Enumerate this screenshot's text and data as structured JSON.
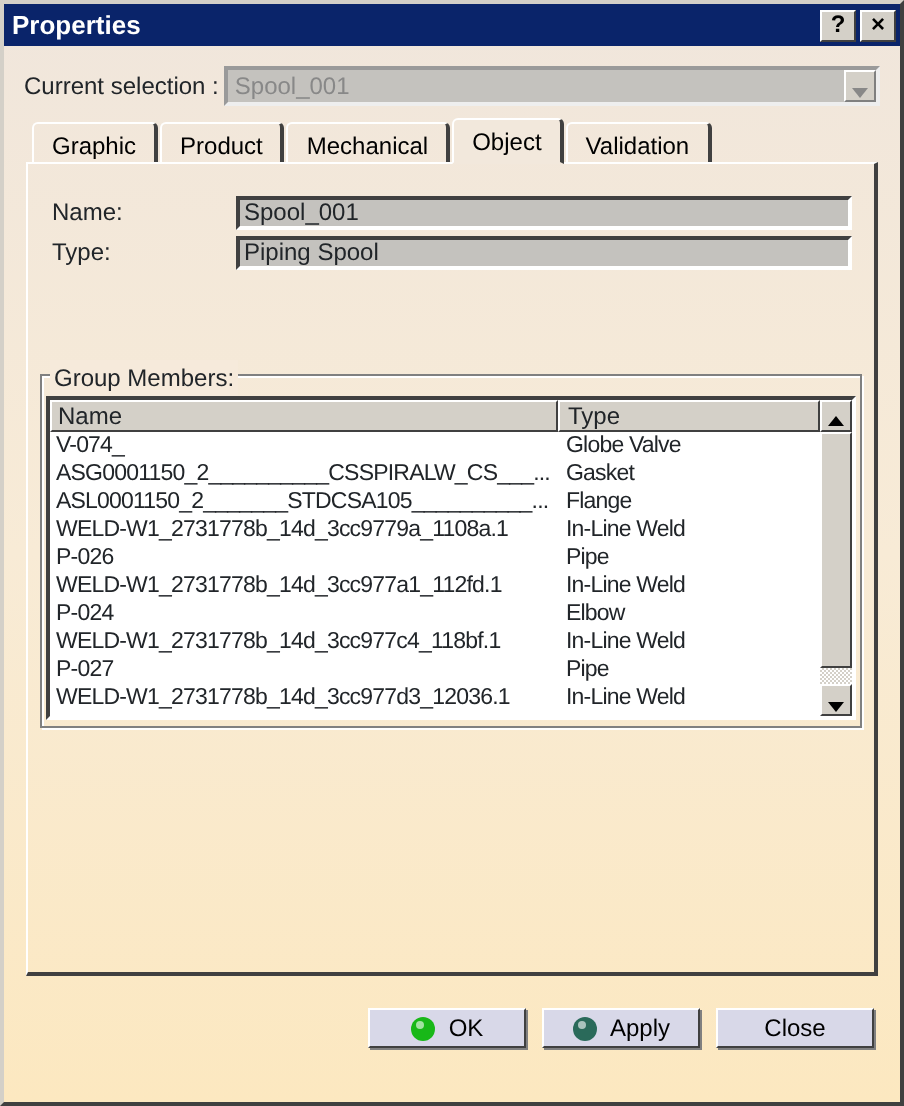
{
  "window": {
    "title": "Properties",
    "title_buttons": [
      "?",
      "×"
    ]
  },
  "current_selection": {
    "label": "Current selection :",
    "value": "Spool_001",
    "disabled": true
  },
  "tabs": [
    {
      "label": "Graphic",
      "selected": false
    },
    {
      "label": "Product",
      "selected": false
    },
    {
      "label": "Mechanical",
      "selected": false
    },
    {
      "label": "Object",
      "selected": true
    },
    {
      "label": "Validation",
      "selected": false
    }
  ],
  "fields": [
    {
      "label": "Name:",
      "value": "Spool_001"
    },
    {
      "label": "Type:",
      "value": "Piping Spool"
    }
  ],
  "group_members": {
    "title": "Group Members:",
    "columns": [
      "Name",
      "Type"
    ],
    "rows": [
      [
        "V-074_",
        "Globe Valve"
      ],
      [
        "ASG0001150_2__________CSSPIRALW_CS___...",
        "Gasket"
      ],
      [
        "ASL0001150_2_______STDCSA105__________...",
        "Flange"
      ],
      [
        "WELD-W1_2731778b_14d_3cc9779a_1108a.1",
        "In-Line Weld"
      ],
      [
        "P-026",
        "Pipe"
      ],
      [
        "WELD-W1_2731778b_14d_3cc977a1_112fd.1",
        "In-Line Weld"
      ],
      [
        "P-024",
        "Elbow"
      ],
      [
        "WELD-W1_2731778b_14d_3cc977c4_118bf.1",
        "In-Line Weld"
      ],
      [
        "P-027",
        "Pipe"
      ],
      [
        "WELD-W1_2731778b_14d_3cc977d3_12036.1",
        "In-Line Weld"
      ]
    ]
  },
  "buttons": [
    {
      "label": "OK",
      "color": "#18b818"
    },
    {
      "label": "Apply",
      "color": "#2a6a5a"
    },
    {
      "label": "Close"
    }
  ]
}
